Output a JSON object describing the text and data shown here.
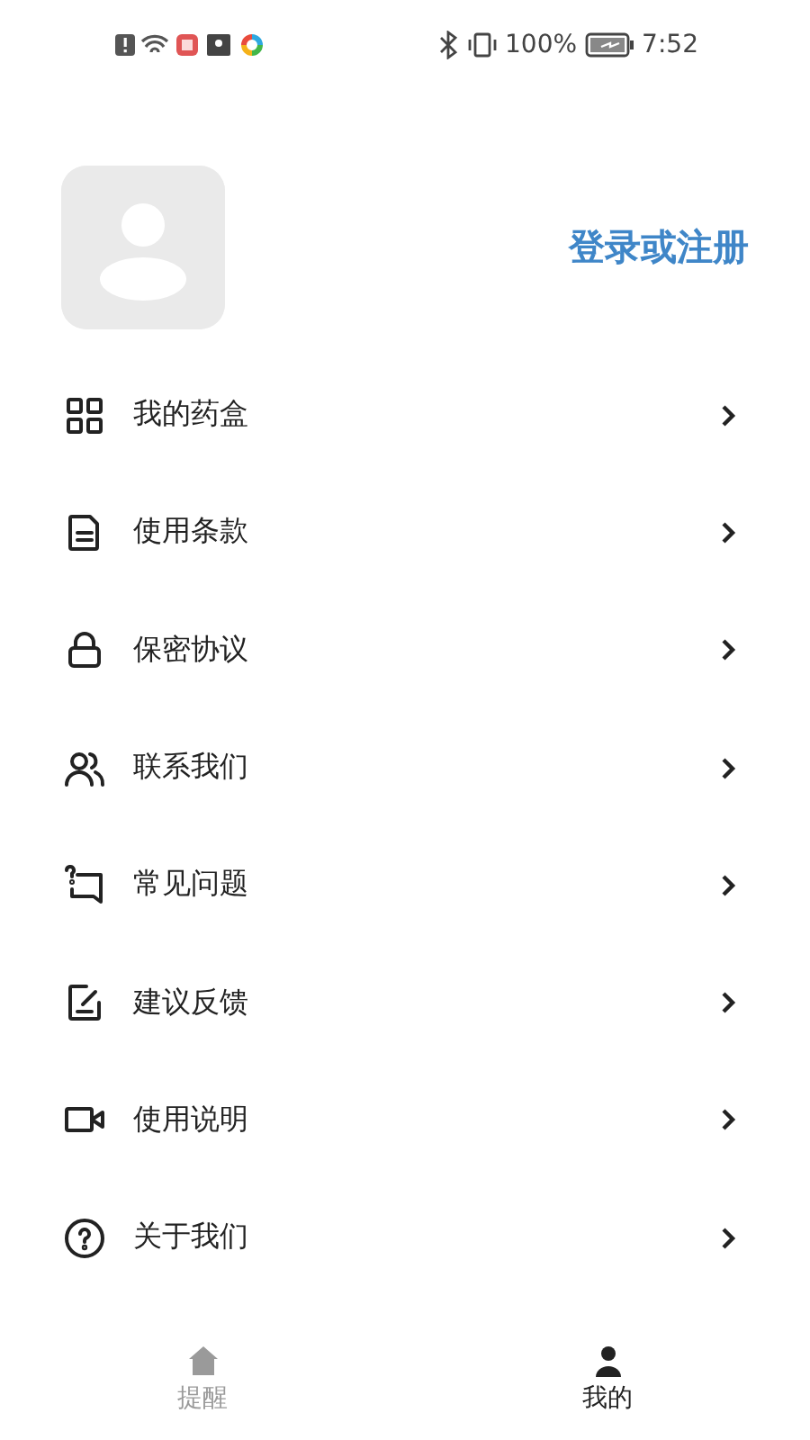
{
  "status_bar": {
    "battery": "100%",
    "time": "7:52"
  },
  "profile": {
    "login": "登录或注册"
  },
  "menu": [
    {
      "label": "我的药盒",
      "kind": "grid"
    },
    {
      "label": "使用条款",
      "kind": "document"
    },
    {
      "label": "保密协议",
      "kind": "lock"
    },
    {
      "label": "联系我们",
      "kind": "people"
    },
    {
      "label": "常见问题",
      "kind": "question"
    },
    {
      "label": "建议反馈",
      "kind": "feedback"
    },
    {
      "label": "使用说明",
      "kind": "video"
    },
    {
      "label": "关于我们",
      "kind": "help"
    }
  ],
  "tabs": [
    {
      "label": "提醒",
      "kind": "home",
      "selected": false
    },
    {
      "label": "我的",
      "kind": "person",
      "selected": true
    }
  ]
}
